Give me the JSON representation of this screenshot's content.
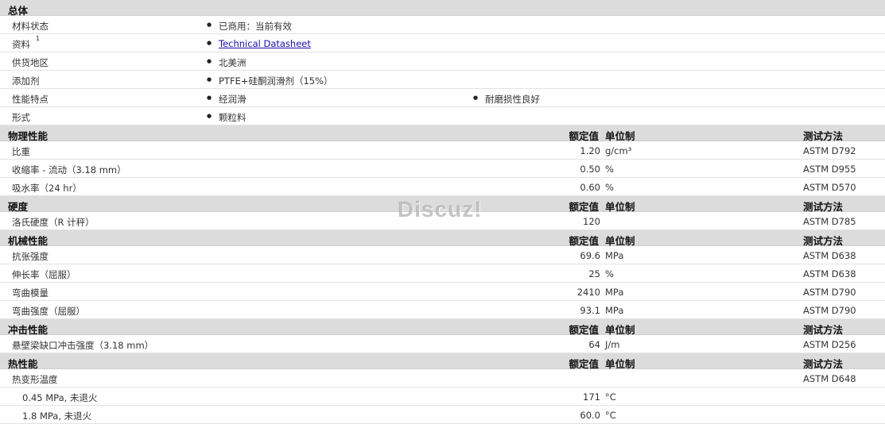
{
  "general": {
    "title": "总体",
    "rows": [
      {
        "label": "材料状态",
        "items": [
          "已商用：当前有效"
        ]
      },
      {
        "label": "资料",
        "sup": "1",
        "link": "Technical Datasheet"
      },
      {
        "label": "供货地区",
        "items": [
          "北美洲"
        ]
      },
      {
        "label": "添加剂",
        "items": [
          "PTFE+硅酮润滑剂（15%）"
        ]
      },
      {
        "label": "性能特点",
        "items": [
          "经润滑",
          "耐磨损性良好"
        ]
      },
      {
        "label": "形式",
        "items": [
          "颗粒料"
        ]
      }
    ]
  },
  "columns": {
    "rated": "额定值",
    "unit": "单位制",
    "method": "测试方法"
  },
  "sections": [
    {
      "title": "物理性能",
      "rows": [
        {
          "label": "比重",
          "value": "1.20",
          "unit": "g/cm³",
          "method": "ASTM D792"
        },
        {
          "label": "收缩率 - 流动（3.18 mm）",
          "value": "0.50",
          "unit": "%",
          "method": "ASTM D955"
        },
        {
          "label": "吸水率（24 hr）",
          "value": "0.60",
          "unit": "%",
          "method": "ASTM D570"
        }
      ]
    },
    {
      "title": "硬度",
      "rows": [
        {
          "label": "洛氏硬度（R 计秤）",
          "value": "120",
          "unit": "",
          "method": "ASTM D785"
        }
      ]
    },
    {
      "title": "机械性能",
      "rows": [
        {
          "label": "抗张强度",
          "value": "69.6",
          "unit": "MPa",
          "method": "ASTM D638"
        },
        {
          "label": "伸长率（屈服）",
          "value": "25",
          "unit": "%",
          "method": "ASTM D638"
        },
        {
          "label": "弯曲模量",
          "value": "2410",
          "unit": "MPa",
          "method": "ASTM D790"
        },
        {
          "label": "弯曲强度（屈服）",
          "value": "93.1",
          "unit": "MPa",
          "method": "ASTM D790"
        }
      ]
    },
    {
      "title": "冲击性能",
      "rows": [
        {
          "label": "悬壁梁缺口冲击强度（3.18 mm）",
          "value": "64",
          "unit": "J/m",
          "method": "ASTM D256"
        }
      ]
    },
    {
      "title": "热性能",
      "rows": [
        {
          "label": "热变形温度",
          "value": "",
          "unit": "",
          "method": "ASTM D648"
        },
        {
          "label": "0.45 MPa, 未退火",
          "value": "171",
          "unit": "°C",
          "method": "",
          "sub": true
        },
        {
          "label": "1.8 MPa, 未退火",
          "value": "60.0",
          "unit": "°C",
          "method": "",
          "sub": true
        }
      ]
    }
  ],
  "watermark": "Discuz!"
}
